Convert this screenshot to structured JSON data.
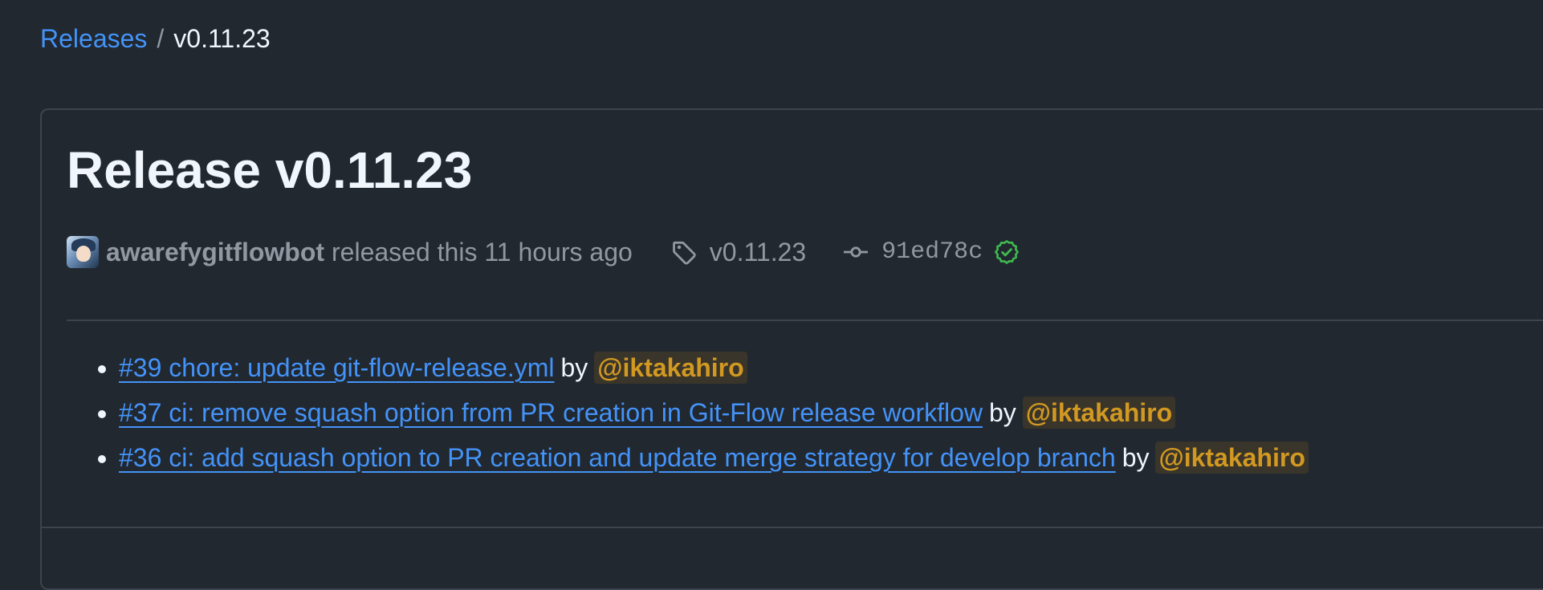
{
  "breadcrumb": {
    "parent": "Releases",
    "separator": "/",
    "current": "v0.11.23"
  },
  "release": {
    "title": "Release v0.11.23",
    "author": "awarefygitflowbot",
    "released_text": "released this 11 hours ago",
    "tag": "v0.11.23",
    "commit": "91ed78c",
    "verified": true
  },
  "notes": [
    {
      "link": "#39 chore: update git-flow-release.yml",
      "by": "by",
      "mention": "@iktakahiro"
    },
    {
      "link": "#37 ci: remove squash option from PR creation in Git-Flow release workflow",
      "by": "by",
      "mention": "@iktakahiro"
    },
    {
      "link": "#36 ci: add squash option to PR creation and update merge strategy for develop branch",
      "by": "by",
      "mention": "@iktakahiro"
    }
  ],
  "icons": {
    "tag": "tag-icon",
    "commit": "git-commit-icon",
    "verified": "verified-badge-icon"
  },
  "colors": {
    "background": "#212830",
    "link": "#4493f8",
    "muted": "#9198a1",
    "mention": "#d29922",
    "verified": "#3fb950"
  }
}
